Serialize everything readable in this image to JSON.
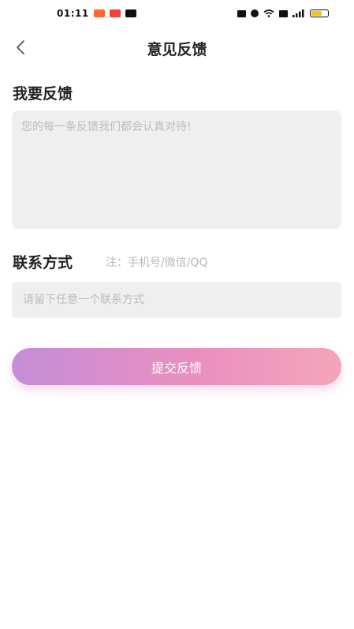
{
  "status_bar": {
    "time": "01:11"
  },
  "header": {
    "title": "意见反馈",
    "back_icon": "chevron-left-icon"
  },
  "feedback": {
    "label": "我要反馈",
    "placeholder": "您的每一条反馈我们都会认真对待!",
    "value": ""
  },
  "contact": {
    "label": "联系方式",
    "note": "注：手机号/微信/QQ",
    "placeholder": "请留下任意一个联系方式",
    "value": ""
  },
  "submit": {
    "label": "提交反馈"
  },
  "colors": {
    "gradient_start": "#c58ed8",
    "gradient_mid": "#e98fbf",
    "gradient_end": "#f4a5ba",
    "input_bg": "#efefef",
    "battery": "#f5c518"
  }
}
